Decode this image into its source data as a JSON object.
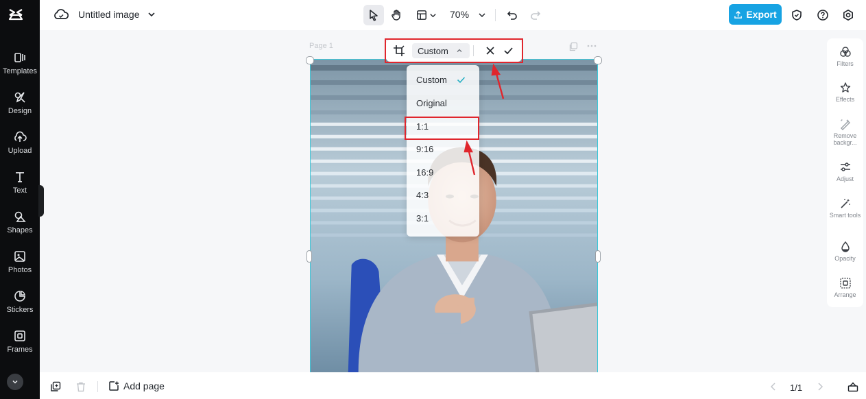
{
  "header": {
    "doc_title": "Untitled image",
    "zoom": "70%",
    "export_label": "Export"
  },
  "sidebar": {
    "items": [
      {
        "label": "Templates",
        "icon": "templates-icon"
      },
      {
        "label": "Design",
        "icon": "design-icon"
      },
      {
        "label": "Upload",
        "icon": "upload-icon"
      },
      {
        "label": "Text",
        "icon": "text-icon"
      },
      {
        "label": "Shapes",
        "icon": "shapes-icon"
      },
      {
        "label": "Photos",
        "icon": "photos-icon"
      },
      {
        "label": "Stickers",
        "icon": "stickers-icon"
      },
      {
        "label": "Frames",
        "icon": "frames-icon"
      }
    ]
  },
  "canvas": {
    "page_label": "Page 1"
  },
  "crop": {
    "selected": "Custom",
    "options": [
      "Custom",
      "Original",
      "1:1",
      "9:16",
      "16:9",
      "4:3",
      "3:1"
    ],
    "highlighted": "1:1"
  },
  "right_panel": {
    "items": [
      {
        "label": "Filters",
        "icon": "filters-icon"
      },
      {
        "label": "Effects",
        "icon": "effects-icon"
      },
      {
        "label": "Remove backgr...",
        "icon": "remove-background-icon"
      },
      {
        "label": "Adjust",
        "icon": "adjust-icon"
      },
      {
        "label": "Smart tools",
        "icon": "smart-tools-icon"
      },
      {
        "label": "Opacity",
        "icon": "opacity-icon"
      },
      {
        "label": "Arrange",
        "icon": "arrange-icon"
      }
    ]
  },
  "footer": {
    "add_page": "Add page",
    "pager": "1/1"
  },
  "colors": {
    "accent": "#17a3e3",
    "selection": "#3fc7d8",
    "annotation": "#e0262d",
    "sidebar_bg": "#0c0d0f"
  }
}
